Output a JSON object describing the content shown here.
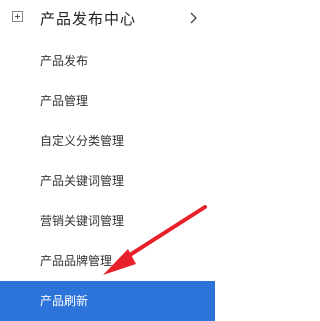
{
  "menu": {
    "header": {
      "title": "产品发布中心",
      "expand_icon": "plus-square-icon",
      "chevron_icon": "chevron-right-icon"
    },
    "items": [
      {
        "label": "产品发布",
        "active": false
      },
      {
        "label": "产品管理",
        "active": false
      },
      {
        "label": "自定义分类管理",
        "active": false
      },
      {
        "label": "产品关键词管理",
        "active": false
      },
      {
        "label": "营销关键词管理",
        "active": false
      },
      {
        "label": "产品品牌管理",
        "active": false
      },
      {
        "label": "产品刷新",
        "active": true
      }
    ],
    "colors": {
      "active_background": "#2c74d9",
      "active_text": "#ffffff",
      "text": "#333333",
      "annotation_arrow": "#e8202a"
    }
  },
  "annotation": {
    "icon": "red-pointer-arrow-icon"
  }
}
